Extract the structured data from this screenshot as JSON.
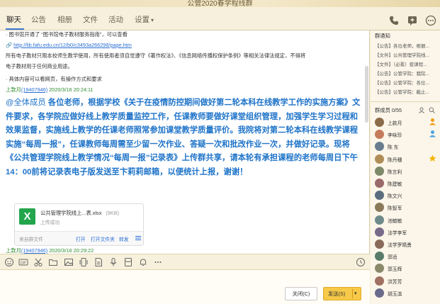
{
  "window": {
    "title": "公管2020春学程线群"
  },
  "tabs": [
    {
      "label": "聊天",
      "active": true
    },
    {
      "label": "公告"
    },
    {
      "label": "相册"
    },
    {
      "label": "文件"
    },
    {
      "label": "活动"
    },
    {
      "label": "设置",
      "dropdown": true
    }
  ],
  "top_icons": [
    "phone-icon",
    "message-plus-icon",
    "more-icon"
  ],
  "messages": {
    "m1_line1": "· 图书馆开通了 “图书馆电子教材服务指南”，可以查看",
    "m1_link": "http://lib.fafu.edu.cn/12/b0/c3493a266298/page.htm",
    "m1_line3": "所有电子教材只限本校师生教学使用，所有使用者须自觉遵守《著作权法》、《信息网络传播权保护条例》等相关法律法规定，不得将",
    "m1_line4": "电子教材用于任何商业用途。",
    "m1_line5": "· 具体内容可以看网页，有操作方式和要求",
    "m1_sender": "上款月",
    "m1_qq": "(19407946)",
    "m1_time": "2020/3/16 20:24:11",
    "m2_at": "@全体成员",
    "m2_text": " 各位老师，根据学校《关于在疫情防控期间做好第二轮本科在线教学工作的实施方案》文件要求，各学院应做好线上教学质量监控工作，任课教师要做好课堂组织管理，加强学生学习过程和效果监督，实施线上教学的任课老师照常参加课堂教学质量评价。我院将对第二轮本科在线教学课程实施“每周一报”，任课教师每周需至少留一次作业、答疑一次和批改作业一次，并做好记录。现将《公共管理学院线上教学情况“每周一报”记录表》上传群共享，请本轮有承担课程的老师每周日下午14：00前将记录表电子版发送至卞莉莉邮箱，以便统计上报，谢谢！",
    "file": {
      "name": "公共管理学院线上...表.xlsx",
      "size": "(9KB)",
      "status": "上传成功",
      "source": "来自群文件",
      "actions": [
        "打开",
        "打开文件夹",
        "转发"
      ]
    },
    "m2_sender": "上款月",
    "m2_qq": "(19407946)",
    "m2_time": "2020/3/16 20:29:22"
  },
  "toolbar_icons": [
    "emoji-icon",
    "gif-icon",
    "scissors-icon",
    "folder-icon",
    "image-icon",
    "shake-icon",
    "doc-icon",
    "mic-icon",
    "red-packet-icon",
    "bell-icon",
    "more-icon",
    "history-icon"
  ],
  "buttons": {
    "close": "关闭(C)",
    "send": "发送(S)"
  },
  "right": {
    "notice_title": "群通知",
    "notices": [
      "【公告】各位老师，根据...",
      "【文件】公共管理学院线...",
      "【文件】（必看）疫课程...",
      "【公告】公管学院：我院...",
      "【公告】公管学院：各位...",
      "【公告】公管学院：截止..."
    ],
    "members_title": "群成员 0/55",
    "members": [
      {
        "name": "上款月",
        "color": "#8c6b4a",
        "badge": "owner"
      },
      {
        "name": "李咏珍",
        "color": "#c57a5a",
        "badge": "admin"
      },
      {
        "name": "陈 东",
        "color": "#6a7d8f"
      },
      {
        "name": "陈丹穗",
        "color": "#b08d57",
        "badge": "star"
      },
      {
        "name": "陈言利",
        "color": "#7c8a6a"
      },
      {
        "name": "陈建敏",
        "color": "#9a6a6a"
      },
      {
        "name": "陈文兴",
        "color": "#5a6d7f"
      },
      {
        "name": "陈智军",
        "color": "#8a7a5a"
      },
      {
        "name": "池毓敏",
        "color": "#6f8a8a"
      },
      {
        "name": "法学李军",
        "color": "#7a6a8a"
      },
      {
        "name": "法学罗晴勇",
        "color": "#8a6a5a"
      },
      {
        "name": "郭适",
        "color": "#5a7a6a"
      },
      {
        "name": "郭玉辉",
        "color": "#8a8a6a"
      },
      {
        "name": "洪芳芳",
        "color": "#a07060"
      },
      {
        "name": "胡玉滨",
        "color": "#6a6a8a"
      }
    ]
  }
}
